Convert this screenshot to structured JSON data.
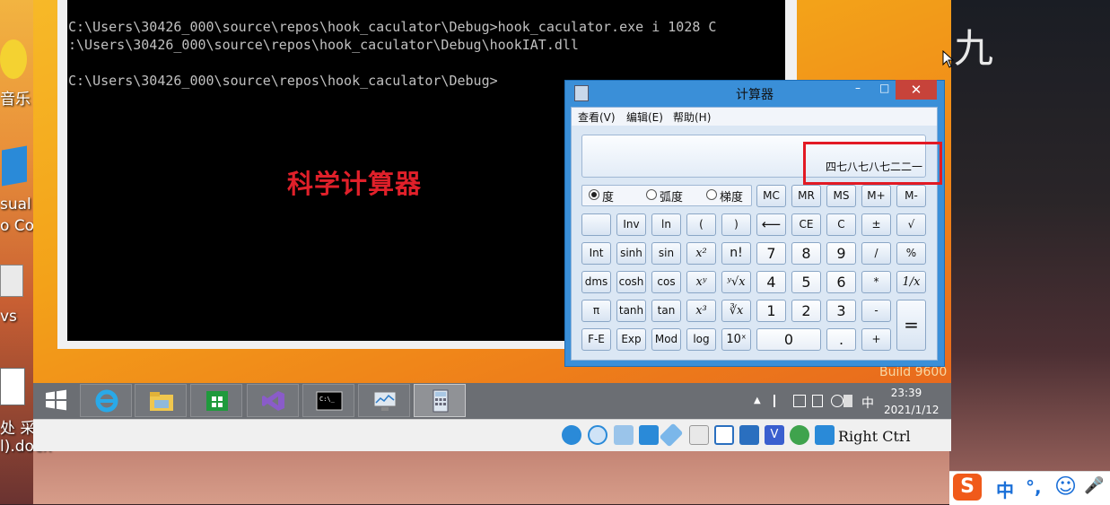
{
  "host": {
    "glyph": "九",
    "desktop_icons": [
      {
        "label": "音乐",
        "icon": "music-app-icon"
      },
      {
        "label": "sual",
        "icon": "visual-studio-icon"
      },
      {
        "label": "o Co",
        "icon": "visual-studio-icon"
      },
      {
        "label": "vs",
        "icon": "vs-shortcut-icon"
      },
      {
        "label": "处 采",
        "icon": "document-icon"
      },
      {
        "label": "l).docx",
        "icon": "document-icon"
      }
    ]
  },
  "console": {
    "lines": [
      "C:\\Users\\30426_000\\source\\repos\\hook_caculator\\Debug>hook_caculator.exe i 1028 C",
      ":\\Users\\30426_000\\source\\repos\\hook_caculator\\Debug\\hookIAT.dll",
      "C:\\Users\\30426_000\\source\\repos\\hook_caculator\\Debug>"
    ]
  },
  "overlay_label": "科学计算器",
  "build_text": "Build 9600",
  "calculator": {
    "title": "计算器",
    "controls": {
      "minimize": "–",
      "maximize": "□",
      "close": "✕"
    },
    "menu": [
      "查看(V)",
      "编辑(E)",
      "帮助(H)"
    ],
    "display_value": "四七八七八七二二一",
    "angle_modes": [
      {
        "label": "度",
        "selected": true
      },
      {
        "label": "弧度",
        "selected": false
      },
      {
        "label": "梯度",
        "selected": false
      }
    ],
    "memory_keys": [
      "MC",
      "MR",
      "MS",
      "M+",
      "M-"
    ],
    "rows": [
      [
        "",
        "Inv",
        "ln",
        "(",
        ")",
        "⟵",
        "CE",
        "C",
        "±",
        "√"
      ],
      [
        "Int",
        "sinh",
        "sin",
        "x²",
        "n!",
        "7",
        "8",
        "9",
        "/",
        "%"
      ],
      [
        "dms",
        "cosh",
        "cos",
        "xʸ",
        "ʸ√x",
        "4",
        "5",
        "6",
        "*",
        "1/x"
      ],
      [
        "π",
        "tanh",
        "tan",
        "x³",
        "∛x",
        "1",
        "2",
        "3",
        "-",
        "="
      ],
      [
        "F-E",
        "Exp",
        "Mod",
        "log",
        "10ˣ",
        "0",
        ".",
        "+"
      ]
    ]
  },
  "taskbar": {
    "apps": [
      {
        "name": "start-button",
        "icon": "windows-logo-icon"
      },
      {
        "name": "ie-button",
        "icon": "internet-explorer-icon"
      },
      {
        "name": "explorer-button",
        "icon": "folder-icon"
      },
      {
        "name": "store-button",
        "icon": "store-icon"
      },
      {
        "name": "vs-button",
        "icon": "visual-studio-icon"
      },
      {
        "name": "cmd-button",
        "icon": "console-icon"
      },
      {
        "name": "perfmon-button",
        "icon": "monitor-icon"
      },
      {
        "name": "calc-button",
        "icon": "calculator-icon",
        "active": true
      }
    ],
    "tray": {
      "ime": "中",
      "time": "23:39",
      "date": "2021/1/12"
    }
  },
  "vbox_status": {
    "host_key": "Right Ctrl"
  },
  "ime_bar": {
    "logo": "S",
    "mode": "中",
    "punct": "°,",
    "emoji": "☺",
    "mic": "🎤"
  },
  "colors": {
    "highlight": "#e21a24",
    "overlay_label": "#e0202a",
    "calc_frame": "#3a8fd8",
    "close_button": "#c7433a"
  }
}
